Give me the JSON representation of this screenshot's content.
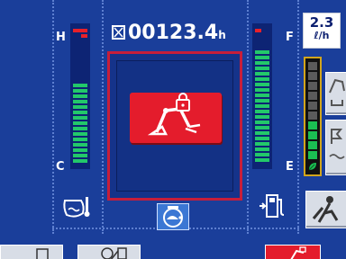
{
  "hour_meter": {
    "value": "00123.4",
    "unit": "h"
  },
  "coolant_gauge": {
    "high_label": "H",
    "low_label": "C"
  },
  "fuel_gauge": {
    "full_label": "F",
    "empty_label": "E"
  },
  "fuel_consumption": {
    "value": "2.3",
    "unit": "ℓ/h"
  },
  "icons": {
    "coolant": "coolant-temperature-icon",
    "fuel": "fuel-pump-icon",
    "engine_mode": "engine-turtle-icon",
    "lock": "hydraulic-lock-icon",
    "work_mode": "work-mode-icon",
    "auto_idle": "auto-idle-icon",
    "operator": "operator-icon",
    "eco": "eco-leaf-icon"
  },
  "colors": {
    "background": "#1a3e9a",
    "alert_red": "#e41c2c",
    "gauge_green": "#23c86a"
  }
}
